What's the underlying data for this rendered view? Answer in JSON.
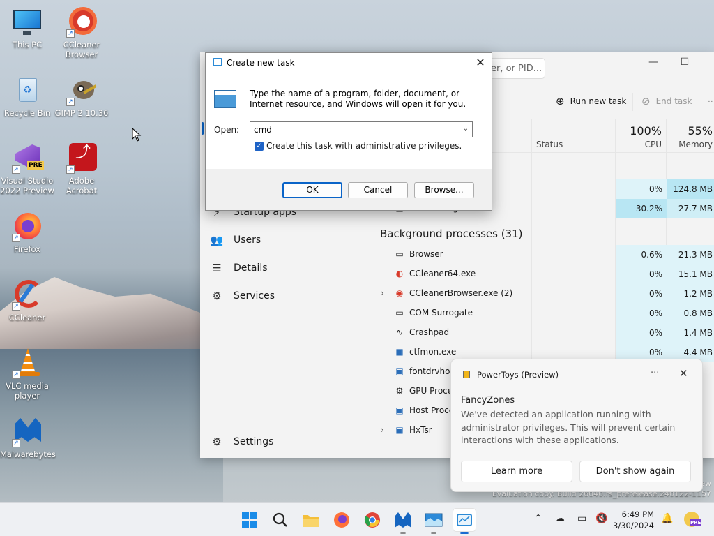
{
  "desktop": {
    "icons": [
      {
        "label": "This PC"
      },
      {
        "label": "CCleaner Browser"
      },
      {
        "label": "Recycle Bin"
      },
      {
        "label": "GIMP 2.10.36"
      },
      {
        "label": "Visual Studio 2022 Preview"
      },
      {
        "label": "Adobe Acrobat"
      },
      {
        "label": "Firefox"
      },
      {
        "label": "CCleaner"
      },
      {
        "label": "VLC media player"
      },
      {
        "label": "Malwarebytes"
      }
    ],
    "watermark_line1": "ew",
    "watermark_line2": "Evaluation copy. Build 26040.rs_prerelease.240122-1157"
  },
  "task_manager": {
    "search_placeholder": "er, or PID...",
    "run_new_task": "Run new task",
    "end_task": "End task",
    "columns": {
      "status": "Status",
      "cpu_pct": "100%",
      "cpu": "CPU",
      "mem_pct": "55%",
      "memory": "Memory"
    },
    "nav": {
      "startup_apps": "Startup apps",
      "users": "Users",
      "details": "Details",
      "services": "Services",
      "settings": "Settings"
    },
    "top_rows": [
      {
        "name": "",
        "cpu": "0%",
        "mem": "124.8 MB"
      },
      {
        "name": "Task Manager",
        "cpu": "30.2%",
        "mem": "27.7 MB"
      }
    ],
    "background_title": "Background processes (31)",
    "processes": [
      {
        "name": "Browser",
        "cpu": "0.6%",
        "mem": "21.3 MB",
        "expand": false
      },
      {
        "name": "CCleaner64.exe",
        "cpu": "0%",
        "mem": "15.1 MB",
        "expand": false
      },
      {
        "name": "CCleanerBrowser.exe (2)",
        "cpu": "0%",
        "mem": "1.2 MB",
        "expand": true
      },
      {
        "name": "COM Surrogate",
        "cpu": "0%",
        "mem": "0.8 MB",
        "expand": false
      },
      {
        "name": "Crashpad",
        "cpu": "0%",
        "mem": "1.4 MB",
        "expand": false
      },
      {
        "name": "ctfmon.exe",
        "cpu": "0%",
        "mem": "4.4 MB",
        "expand": false
      },
      {
        "name": "fontdrvhos",
        "cpu": "",
        "mem": "",
        "expand": false
      },
      {
        "name": "GPU Proces",
        "cpu": "",
        "mem": "",
        "expand": false
      },
      {
        "name": "Host Proce",
        "cpu": "",
        "mem": "",
        "expand": false
      },
      {
        "name": "HxTsr",
        "cpu": "",
        "mem": "",
        "expand": true
      }
    ]
  },
  "dialog": {
    "title": "Create new task",
    "description": "Type the name of a program, folder, document, or Internet resource, and Windows will open it for you.",
    "open_label": "Open:",
    "open_value": "cmd",
    "admin_checkbox_label": "Create this task with administrative privileges.",
    "admin_checked": true,
    "ok": "OK",
    "cancel": "Cancel",
    "browse": "Browse..."
  },
  "toast": {
    "app_name": "PowerToys (Preview)",
    "more": "···",
    "heading": "FancyZones",
    "message": "We've detected an application running with administrator privileges. This will prevent certain interactions with these applications.",
    "learn_more": "Learn more",
    "dont_show": "Don't show again"
  },
  "taskbar": {
    "time": "6:49 PM",
    "date": "3/30/2024"
  },
  "colors": {
    "accent": "#0a64c8",
    "cpu_highlight": "#def3f9"
  }
}
